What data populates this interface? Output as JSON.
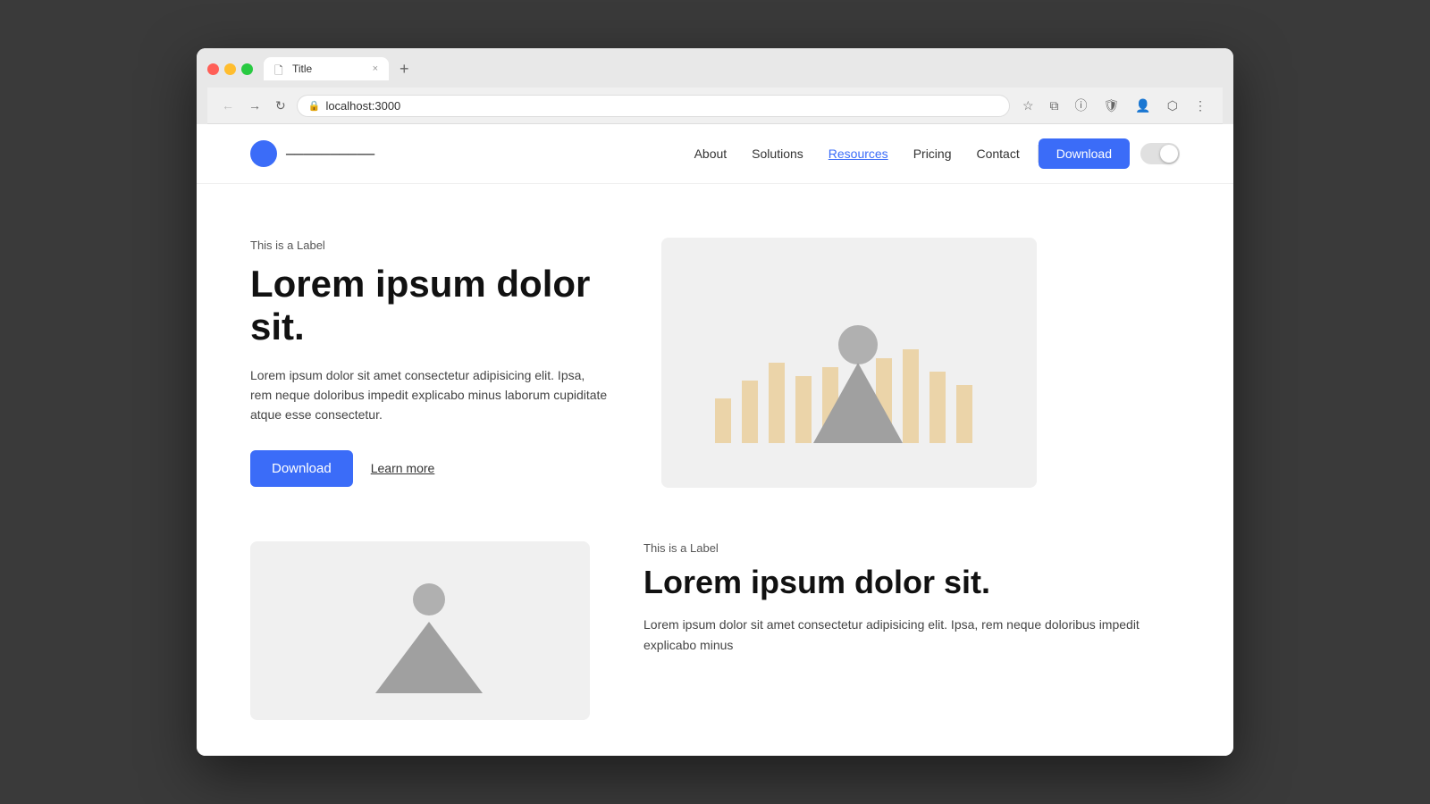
{
  "browser": {
    "tab_title": "Title",
    "url": "localhost:3000",
    "tab_close": "×",
    "tab_new": "+",
    "back_icon": "←",
    "forward_icon": "→",
    "refresh_icon": "↻"
  },
  "navbar": {
    "logo_text": "──────────",
    "links": [
      {
        "label": "About",
        "active": false
      },
      {
        "label": "Solutions",
        "active": false
      },
      {
        "label": "Resources",
        "active": true
      },
      {
        "label": "Pricing",
        "active": false
      },
      {
        "label": "Contact",
        "active": false
      }
    ],
    "download_label": "Download"
  },
  "hero": {
    "label": "This is a Label",
    "title": "Lorem ipsum dolor sit.",
    "description": "Lorem ipsum dolor sit amet consectetur adipisicing elit. Ipsa, rem neque doloribus impedit explicabo minus laborum cupiditate atque esse consectetur.",
    "download_label": "Download",
    "learn_more_label": "Learn more"
  },
  "second": {
    "label": "This is a Label",
    "title": "Lorem ipsum dolor sit.",
    "description": "Lorem ipsum dolor sit amet consectetur adipisicing elit. Ipsa, rem neque doloribus impedit explicabo minus"
  }
}
